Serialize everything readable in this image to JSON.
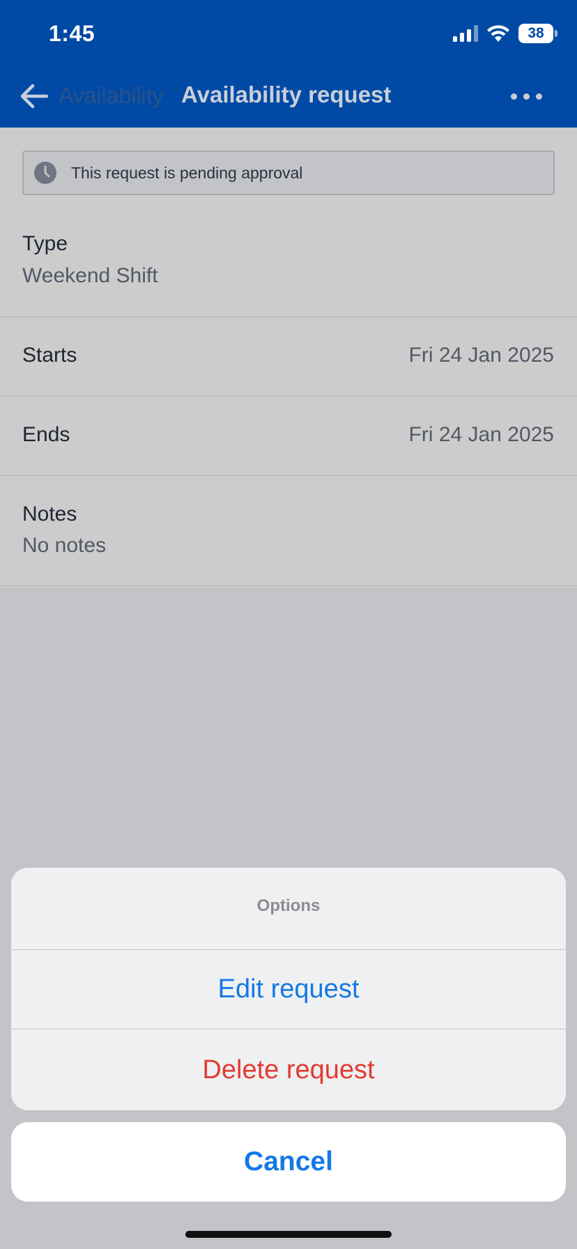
{
  "status_bar": {
    "time": "1:45",
    "battery": "38"
  },
  "nav": {
    "back_label": "Availability",
    "title": "Availability request"
  },
  "banner": {
    "text": "This request is pending approval"
  },
  "details": {
    "type": {
      "label": "Type",
      "value": "Weekend Shift"
    },
    "starts": {
      "label": "Starts",
      "value": "Fri 24 Jan 2025"
    },
    "ends": {
      "label": "Ends",
      "value": "Fri 24 Jan 2025"
    },
    "notes": {
      "label": "Notes",
      "value": "No notes"
    }
  },
  "action_sheet": {
    "title": "Options",
    "edit_label": "Edit request",
    "delete_label": "Delete request",
    "cancel_label": "Cancel"
  },
  "colors": {
    "header": "#004aa6",
    "action_blue": "#1478e6",
    "destructive_red": "#e43a32"
  },
  "icons": {
    "back": "arrow-left-icon",
    "more": "more-horizontal-icon",
    "pending": "clock-icon",
    "signal": "cellular-signal-icon",
    "wifi": "wifi-icon",
    "battery": "battery-icon"
  }
}
